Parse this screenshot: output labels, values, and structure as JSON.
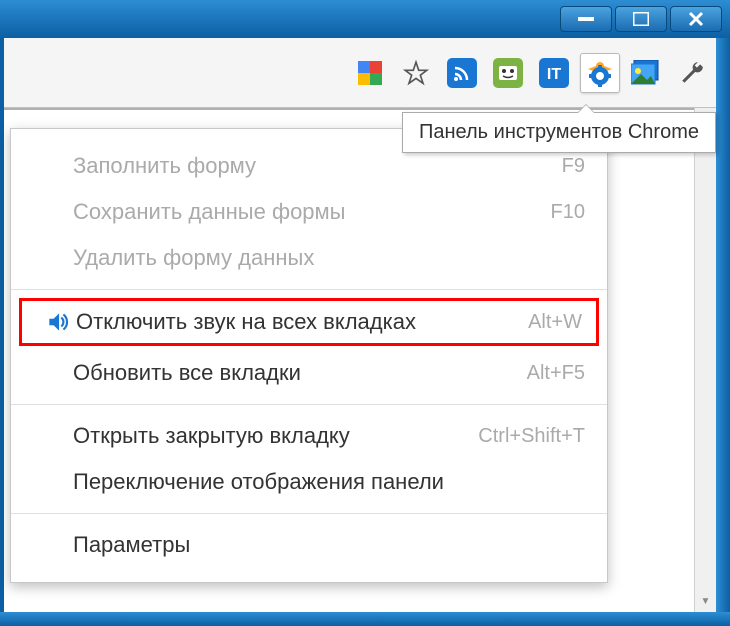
{
  "tooltip": {
    "text": "Панель инструментов Chrome"
  },
  "menu": {
    "items": [
      {
        "label": "Заполнить форму",
        "shortcut": "F9",
        "disabled": true
      },
      {
        "label": "Сохранить данные формы",
        "shortcut": "F10",
        "disabled": true
      },
      {
        "label": "Удалить форму данных",
        "shortcut": "",
        "disabled": true
      },
      {
        "label": "Отключить звук на всех вкладках",
        "shortcut": "Alt+W",
        "highlighted": true,
        "icon": "speaker"
      },
      {
        "label": "Обновить все вкладки",
        "shortcut": "Alt+F5"
      },
      {
        "label": "Открыть закрытую вкладку",
        "shortcut": "Ctrl+Shift+T"
      },
      {
        "label": "Переключение отображения панели",
        "shortcut": ""
      },
      {
        "label": "Параметры",
        "shortcut": ""
      }
    ]
  },
  "extensions": {
    "icons": [
      "google-icon",
      "star-icon",
      "rss-icon",
      "translate-icon",
      "it-icon",
      "gear-icon",
      "image-icon",
      "wrench-icon"
    ]
  }
}
